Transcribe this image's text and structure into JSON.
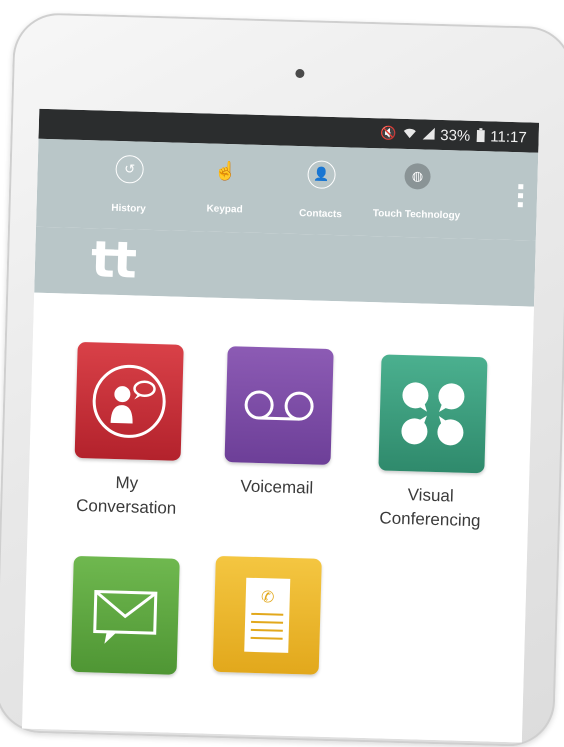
{
  "status_bar": {
    "icons": [
      "mute-icon",
      "wifi-icon",
      "signal-icon",
      "battery-icon"
    ],
    "battery": "33%",
    "time": "11:17"
  },
  "toolbar": {
    "items": [
      {
        "label": "History",
        "icon": "history-icon"
      },
      {
        "label": "Keypad",
        "icon": "keypad-hand-icon"
      },
      {
        "label": "Contacts",
        "icon": "contacts-icon"
      },
      {
        "label": "Touch Technology",
        "icon": "globe-icon"
      }
    ],
    "menu_icon": "overflow-menu-icon"
  },
  "brand": {
    "logo_text": "tt"
  },
  "apps": [
    {
      "line1": "My",
      "line2": "Conversation",
      "icon": "conversation-icon",
      "color": "#c62e36"
    },
    {
      "line1": "Voicemail",
      "line2": "",
      "icon": "voicemail-icon",
      "color": "#7c4ca8"
    },
    {
      "line1": "Visual",
      "line2": "Conferencing",
      "icon": "conferencing-icon",
      "color": "#3a9c7c"
    },
    {
      "line1": "",
      "line2": "",
      "icon": "message-icon",
      "color": "#5ea640"
    },
    {
      "line1": "",
      "line2": "",
      "icon": "call-log-icon",
      "color": "#ecb830"
    }
  ]
}
